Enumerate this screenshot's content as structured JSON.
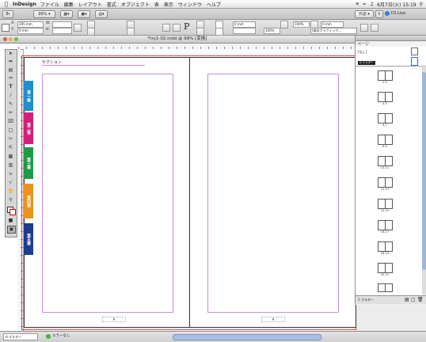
{
  "menubar": {
    "apple": "",
    "app_name": "InDesign",
    "items": [
      "ファイル",
      "編集",
      "レイアウト",
      "書式",
      "オブジェクト",
      "表",
      "表示",
      "ウィンドウ",
      "ヘルプ"
    ],
    "clock": "6月7日(火) 15:19"
  },
  "appbar": {
    "zoom": "99%",
    "workspace": "YUJI",
    "cs_live": "CS Live"
  },
  "control": {
    "x_label": "X:",
    "x_value": "295 mm",
    "y_label": "Y:",
    "y_value": "0 mm",
    "w_label": "W:",
    "h_label": "H:",
    "stroke_weight": "0 mm",
    "pct_a": "100%",
    "pct_b": "100%",
    "gap_value": "0 mm",
    "frame_fit": "[基本グラフィック..."
  },
  "document": {
    "title": "*try1-02.indd @ 99% [変換]",
    "header_text": "セクション",
    "folio_left": "A",
    "folio_right": "A",
    "tabs": [
      {
        "label": "第一章",
        "color": "#1f8ecf"
      },
      {
        "label": "第二章",
        "color": "#d2207a"
      },
      {
        "label": "第三章",
        "color": "#1f9a4a"
      },
      {
        "label": "第四章",
        "color": "#e9941c"
      },
      {
        "label": "第五章",
        "color": "#1b3d8f"
      }
    ]
  },
  "statusbar": {
    "page": "A-マスター",
    "preflight": "エラーなし"
  },
  "pages_panel": {
    "title": "ページ",
    "none_label": "[なし]",
    "master_label": "A-マスター",
    "spreads": [
      "2-3",
      "4-5",
      "6-7",
      "8-9",
      "10-11",
      "12-13",
      "14-15",
      "16-17",
      "18-19",
      "20-21"
    ],
    "footer_label": "1 マスター"
  },
  "tools": [
    "selection-tool",
    "direct-selection-tool",
    "page-tool",
    "gap-tool",
    "type-tool",
    "line-tool",
    "pen-tool",
    "pencil-tool",
    "rectangle-frame-tool",
    "rectangle-tool",
    "scissors-tool",
    "free-transform-tool",
    "gradient-swatch-tool",
    "gradient-feather-tool",
    "note-tool",
    "eyedropper-tool",
    "hand-tool",
    "zoom-tool",
    "fill-stroke-swatch",
    "view-mode-button"
  ]
}
